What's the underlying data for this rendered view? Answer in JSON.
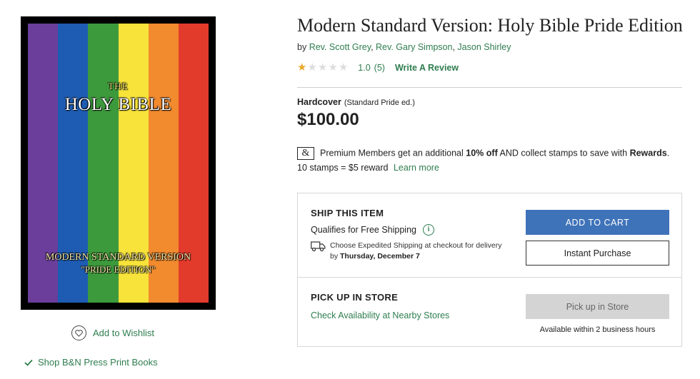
{
  "product": {
    "title": "Modern Standard Version: Holy Bible Pride Edition",
    "by_prefix": "by",
    "authors": [
      "Rev. Scott Grey",
      "Rev. Gary Simpson",
      "Jason Shirley"
    ],
    "rating": {
      "value": "1.0",
      "count": "(5)",
      "stars_filled": 1,
      "stars_total": 5,
      "write_review": "Write A Review"
    },
    "format": "Hardcover",
    "edition": "(Standard Pride ed.)",
    "price": "$100.00"
  },
  "cover": {
    "line1": "THE",
    "line2": "HOLY BIBLE",
    "line3": "MODERN STANDARD VERSION",
    "line4": "\"PRIDE EDITION\"",
    "stripe_colors": [
      "#6a3e9a",
      "#1e5cb3",
      "#3c9a3c",
      "#f7e33a",
      "#f28a2e",
      "#e23b2b"
    ]
  },
  "premium": {
    "icon": "&",
    "text_before": "Premium Members get an additional",
    "highlight": "10% off",
    "text_mid": "AND collect stamps to save with",
    "rewards": "Rewards",
    "period": ".",
    "stamps": "10 stamps = $5 reward",
    "learn_more": "Learn more"
  },
  "ship": {
    "title": "SHIP THIS ITEM",
    "qualifies": "Qualifies for Free Shipping",
    "expedited_line1": "Choose Expedited Shipping at checkout for delivery",
    "expedited_by": "by",
    "delivery_date": "Thursday, December 7",
    "add_to_cart": "ADD TO CART",
    "instant_purchase": "Instant Purchase"
  },
  "pickup": {
    "title": "PICK UP IN STORE",
    "check_link": "Check Availability at Nearby Stores",
    "button": "Pick up in Store",
    "availability": "Available within 2 business hours"
  },
  "left": {
    "wishlist": "Add to Wishlist",
    "shop_press": "Shop B&N Press Print Books"
  },
  "colors": {
    "accent_green": "#2f7d4f",
    "cart_blue": "#3f73b9",
    "star_gold": "#e8a72c"
  }
}
